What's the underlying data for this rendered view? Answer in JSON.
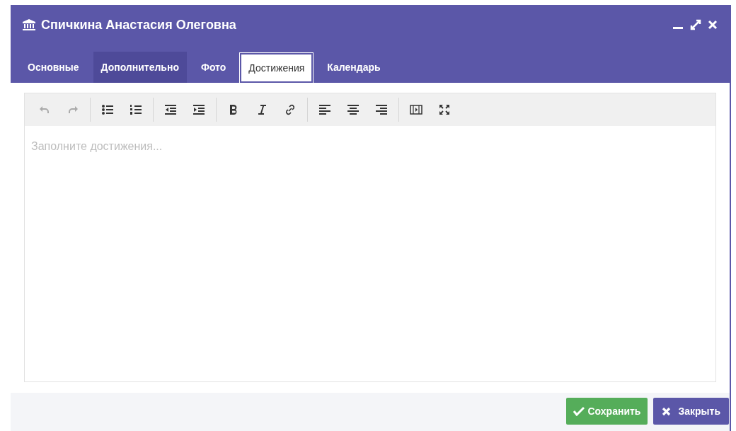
{
  "window": {
    "title": "Спичкина Анастасия Олеговна"
  },
  "tabs": [
    {
      "label": "Основные",
      "selected": false,
      "hovered": false
    },
    {
      "label": "Дополнительно",
      "selected": false,
      "hovered": true
    },
    {
      "label": "Фото",
      "selected": false,
      "hovered": false
    },
    {
      "label": "Достижения",
      "selected": true,
      "hovered": false
    },
    {
      "label": "Календарь",
      "selected": false,
      "hovered": false
    }
  ],
  "toolbar": [
    [
      {
        "kind": "undo",
        "disabled": true
      },
      {
        "kind": "redo",
        "disabled": true
      }
    ],
    [
      {
        "kind": "bullets",
        "disabled": false
      },
      {
        "kind": "numbers",
        "disabled": false
      }
    ],
    [
      {
        "kind": "outdent",
        "disabled": false
      },
      {
        "kind": "indent",
        "disabled": false
      }
    ],
    [
      {
        "kind": "bold",
        "disabled": false
      },
      {
        "kind": "italic",
        "disabled": false
      },
      {
        "kind": "link",
        "disabled": false
      }
    ],
    [
      {
        "kind": "left",
        "disabled": false
      },
      {
        "kind": "center",
        "disabled": false
      },
      {
        "kind": "right",
        "disabled": false
      }
    ],
    [
      {
        "kind": "media",
        "disabled": false
      },
      {
        "kind": "fullscreen",
        "disabled": false
      }
    ]
  ],
  "editor": {
    "placeholder": "Заполните достижения..."
  },
  "buttons": [
    {
      "kind": "save",
      "label": "Сохранить"
    },
    {
      "kind": "close",
      "label": "Закрыть"
    }
  ]
}
